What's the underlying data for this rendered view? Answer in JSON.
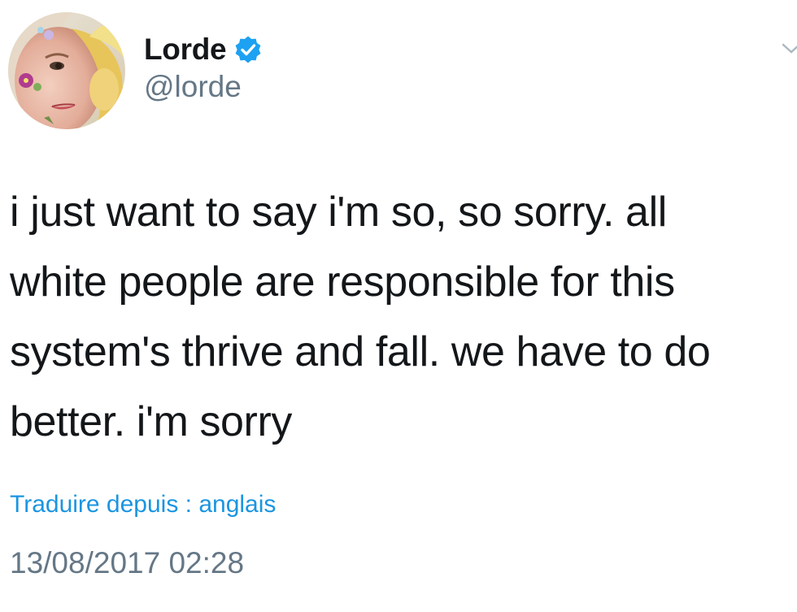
{
  "author": {
    "display_name": "Lorde",
    "handle": "@lorde",
    "verified": true
  },
  "icons": {
    "verified": "verified-badge-icon",
    "menu": "chevron-down-icon",
    "avatar": "profile-photo"
  },
  "tweet": {
    "text_lines": [
      "i just want to say i'm so, so sorry. all",
      "white people are responsible for this",
      "system's thrive and fall. we have to do",
      "better. i'm sorry"
    ],
    "translate_label": "Traduire depuis : anglais",
    "timestamp": "13/08/2017 02:28"
  },
  "colors": {
    "text": "#14171a",
    "secondary": "#657786",
    "link": "#1b95e0",
    "verified": "#1da1f2"
  }
}
